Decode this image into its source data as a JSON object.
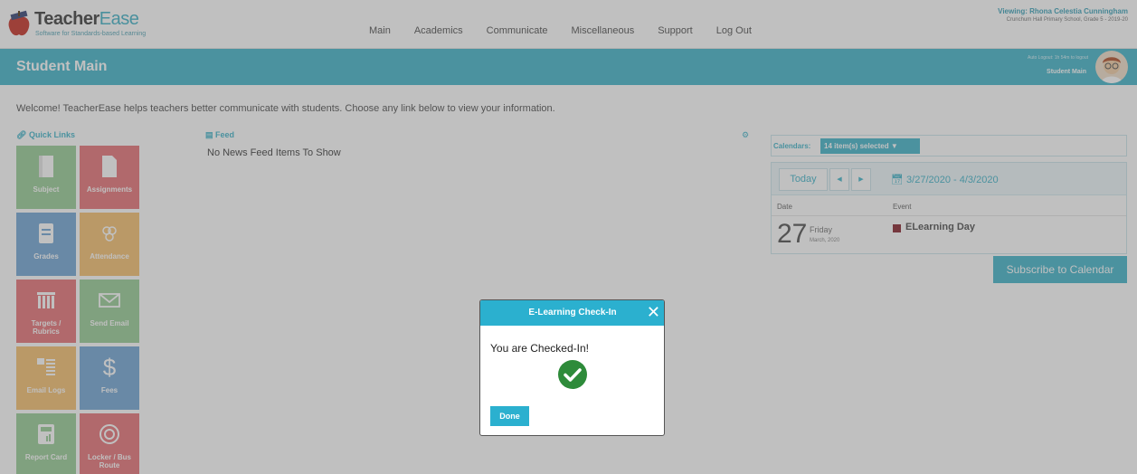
{
  "header": {
    "brand_main": "Teacher",
    "brand_accent": "Ease",
    "tagline": "Software for Standards-based Learning",
    "nav": [
      "Main",
      "Academics",
      "Communicate",
      "Miscellaneous",
      "Support",
      "Log Out"
    ],
    "viewing": "Viewing: Rhona Celestia Cunningham",
    "school": "Crunchum Hall Primary School, Grade 5 - 2019-20"
  },
  "titlebar": {
    "page_title": "Student Main",
    "auto_logout": "Auto Logout: 1h 54m to logout",
    "page_subtitle": "Student Main"
  },
  "welcome": "Welcome! TeacherEase helps teachers better communicate with students. Choose any link below to view your information.",
  "quick_links": {
    "header": "Quick Links",
    "tiles": [
      {
        "label": "Subject",
        "icon": "book-icon",
        "color": "#9ccf99"
      },
      {
        "label": "Assignments",
        "icon": "document-icon",
        "color": "#e8777c"
      },
      {
        "label": "Grades",
        "icon": "gradebook-icon",
        "color": "#77a9d6"
      },
      {
        "label": "Attendance",
        "icon": "people-icon",
        "color": "#f6c274"
      },
      {
        "label": "Targets / Rubrics",
        "icon": "grid-icon",
        "color": "#e8777c"
      },
      {
        "label": "Send Email",
        "icon": "envelope-icon",
        "color": "#9ccf99"
      },
      {
        "label": "Email Logs",
        "icon": "email-log-icon",
        "color": "#f6c274"
      },
      {
        "label": "Fees",
        "icon": "dollar-icon",
        "color": "#77a9d6"
      },
      {
        "label": "Report Card",
        "icon": "report-card-icon",
        "color": "#9ccf99"
      },
      {
        "label": "Locker / Bus Route",
        "icon": "lock-dial-icon",
        "color": "#e8777c"
      }
    ]
  },
  "feed": {
    "header": "Feed",
    "empty": "No News Feed Items To Show"
  },
  "calendar": {
    "label": "Calendars:",
    "selected": "14 item(s) selected",
    "today": "Today",
    "range": "3/27/2020 - 4/3/2020",
    "col_date": "Date",
    "col_event": "Event",
    "day_num": "27",
    "day_name": "Friday",
    "month_year": "March, 2020",
    "event": "ELearning Day",
    "event_color": "#8c2b35",
    "subscribe": "Subscribe to Calendar"
  },
  "modal": {
    "title": "E-Learning Check-In",
    "message": "You are Checked-In!",
    "done": "Done",
    "accent": "#2bb0cf",
    "check_color": "#2e8b3a"
  }
}
